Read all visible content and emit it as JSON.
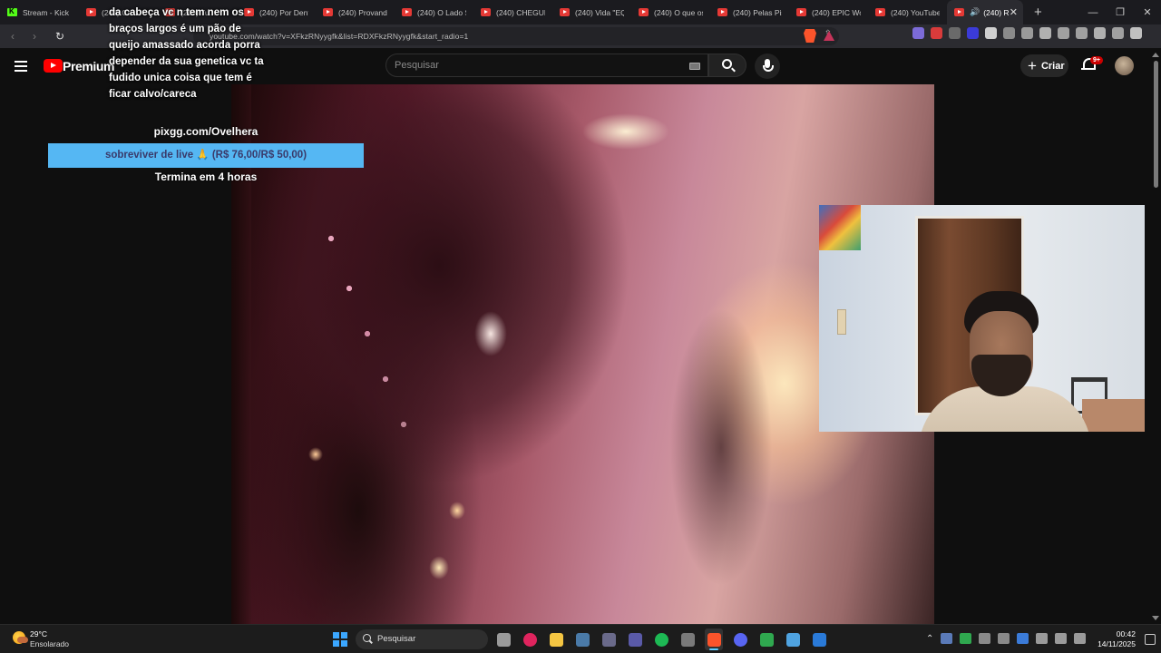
{
  "browser": {
    "tabs": [
      {
        "label": "Stream - Kick D",
        "icon": "kick-icon",
        "active": false
      },
      {
        "label": "(240) Ca...",
        "icon": "youtube-icon",
        "active": false
      },
      {
        "label": "(240) Tu...",
        "icon": "youtube-icon",
        "active": false
      },
      {
        "label": "(240) Por Dentr",
        "icon": "youtube-icon",
        "active": false
      },
      {
        "label": "(240) Provando",
        "icon": "youtube-icon",
        "active": false
      },
      {
        "label": "(240) O Lado S",
        "icon": "youtube-icon",
        "active": false
      },
      {
        "label": "(240) CHEGUEI",
        "icon": "youtube-icon",
        "active": false
      },
      {
        "label": "(240) Vida \"EQ",
        "icon": "youtube-icon",
        "active": false
      },
      {
        "label": "(240) O que os",
        "icon": "youtube-icon",
        "active": false
      },
      {
        "label": "(240) Pelas Pist",
        "icon": "youtube-icon",
        "active": false
      },
      {
        "label": "(240) EPIC Worl",
        "icon": "youtube-icon",
        "active": false
      },
      {
        "label": "(240) YouTube",
        "icon": "youtube-icon",
        "active": false
      },
      {
        "label": "(240) R",
        "icon": "youtube-icon",
        "active": true
      }
    ],
    "new_tab": "+",
    "window_controls": {
      "minimize": "—",
      "restore": "❐",
      "close": "✕"
    },
    "url": "youtube.com/watch?v=XFkzRNyygfk&list=RDXFkzRNyygfk&start_radio=1",
    "back": "‹",
    "forward": "›",
    "reload": "↻"
  },
  "youtube": {
    "logo_text": "Premium",
    "search_placeholder": "Pesquisar",
    "create_label": "Criar",
    "create_plus": "+",
    "notifications_badge": "9+"
  },
  "overlay": {
    "donation_message": "da cabeça vc n tem nem os\nbraços largos é um pão de\nqueijo amassado acorda porra\ndepender da sua genetica vc ta\nfudido unica coisa que tem é\nficar calvo/careca",
    "goal_link": "pixgg.com/Ovelhera",
    "goal_text": "sobreviver de live 🙏 (R$ 76,00/R$ 50,00)",
    "goal_progress": 1.0,
    "goal_ends": "Termina em 4 horas"
  },
  "taskbar": {
    "weather_temp": "29°C",
    "weather_condition": "Ensolarado",
    "search_placeholder": "Pesquisar",
    "time": "00:42",
    "date": "14/11/2025",
    "apps": [
      {
        "name": "task-view-icon",
        "color": "#9a9a9a"
      },
      {
        "name": "opera-icon",
        "color": "#e0245e"
      },
      {
        "name": "file-explorer-icon",
        "color": "#f4c542"
      },
      {
        "name": "steam-icon",
        "color": "#4a7aa8"
      },
      {
        "name": "app-icon",
        "color": "#6a6a8a"
      },
      {
        "name": "app-arrow-icon",
        "color": "#5a5aa8"
      },
      {
        "name": "spotify-icon",
        "color": "#1db954"
      },
      {
        "name": "app-refresh-icon",
        "color": "#7a7a7a"
      },
      {
        "name": "brave-icon",
        "color": "#fb542b"
      },
      {
        "name": "discord-icon",
        "color": "#5865f2"
      },
      {
        "name": "app-play-icon",
        "color": "#2fa84f"
      },
      {
        "name": "notepad-icon",
        "color": "#4fa3e0"
      },
      {
        "name": "app-blue-icon",
        "color": "#2a7ad8"
      }
    ]
  },
  "colors": {
    "goal_bar": "#2196f3",
    "youtube_red": "#ff0000",
    "accent": "#60cdff"
  }
}
